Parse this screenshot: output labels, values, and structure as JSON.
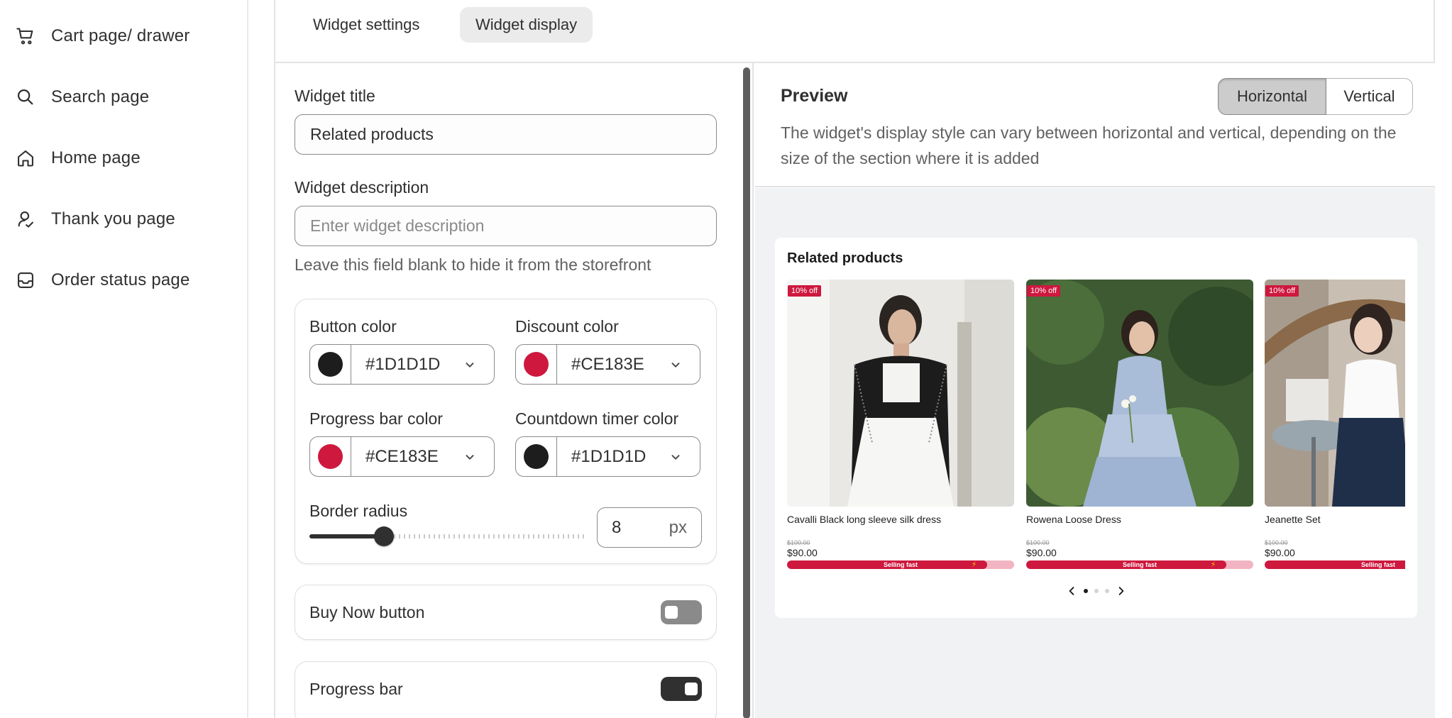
{
  "sidebar": {
    "items": [
      {
        "label": "Cart page/ drawer",
        "icon": "cart-icon"
      },
      {
        "label": "Search page",
        "icon": "search-icon"
      },
      {
        "label": "Home page",
        "icon": "home-icon"
      },
      {
        "label": "Thank you page",
        "icon": "person-icon"
      },
      {
        "label": "Order status page",
        "icon": "inbox-icon"
      }
    ]
  },
  "tabs": [
    {
      "label": "Widget settings",
      "active": false
    },
    {
      "label": "Widget display",
      "active": true
    }
  ],
  "settings": {
    "widget_title_label": "Widget title",
    "widget_title_value": "Related products",
    "widget_description_label": "Widget description",
    "widget_description_placeholder": "Enter widget description",
    "widget_description_help": "Leave this field blank to hide it from the storefront",
    "colors": {
      "button_label": "Button color",
      "button_value": "#1D1D1D",
      "discount_label": "Discount color",
      "discount_value": "#CE183E",
      "progress_label": "Progress bar color",
      "progress_value": "#CE183E",
      "countdown_label": "Countdown timer color",
      "countdown_value": "#1D1D1D"
    },
    "border_radius_label": "Border radius",
    "border_radius_value": "8",
    "border_radius_unit": "px",
    "border_radius_fraction": 0.27,
    "buy_now_label": "Buy Now button",
    "buy_now_on": false,
    "progress_bar_label": "Progress bar",
    "progress_bar_on": true
  },
  "preview": {
    "title": "Preview",
    "orientation_options": [
      "Horizontal",
      "Vertical"
    ],
    "orientation_selected": "Horizontal",
    "description": "The widget's display style can vary between horizontal and vertical, depending on the size of the section where it is added",
    "widget_title": "Related products",
    "products": [
      {
        "name": "Cavalli Black long sleeve silk dress",
        "badge": "10% off",
        "old_price": "$100.00",
        "price": "$90.00",
        "bar_label": "Selling fast",
        "progress": 0.88
      },
      {
        "name": "Rowena Loose Dress",
        "badge": "10% off",
        "old_price": "$100.00",
        "price": "$90.00",
        "bar_label": "Selling fast",
        "progress": 0.88
      },
      {
        "name": "Jeanette Set",
        "badge": "10% off",
        "old_price": "$100.00",
        "price": "$90.00",
        "bar_label": "Selling fast",
        "progress": 0.88
      }
    ],
    "carousel": {
      "pages": 3,
      "current": 1
    }
  },
  "colors": {
    "dark": "#1D1D1D",
    "red": "#CE183E",
    "toggle_off": "#8a8a8a",
    "toggle_on": "#303030"
  }
}
